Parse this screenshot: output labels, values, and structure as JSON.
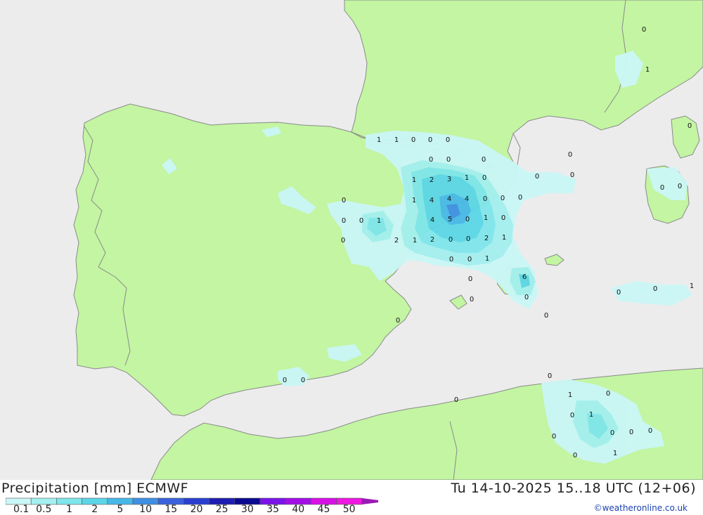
{
  "title": "Precipitation [mm] ECMWF",
  "valid_time": "Tu 14-10-2025 15..18 UTC (12+06)",
  "credit": "©weatheronline.co.uk",
  "colors": {
    "sea": "#ececec",
    "land": "#c3f5a2",
    "border": "#8a8a8a"
  },
  "legend": {
    "labels": [
      "0.1",
      "0.5",
      "1",
      "2",
      "5",
      "10",
      "15",
      "20",
      "25",
      "30",
      "35",
      "40",
      "45",
      "50"
    ],
    "colors": [
      "#caf7f7",
      "#a4efef",
      "#7fe6ea",
      "#5bd6e6",
      "#47b8e8",
      "#3f8fe3",
      "#3a62dc",
      "#2a3fd0",
      "#1e1eb2",
      "#0a0a90",
      "#7a14e8",
      "#a40ee6",
      "#d810e6",
      "#ee18e2",
      "#bb18c8",
      "#9a1ab6"
    ]
  },
  "values": [
    {
      "t": "0",
      "c": "France-north"
    },
    {
      "t": "1",
      "c": "France-north"
    },
    {
      "t": "0",
      "c": "France-east"
    },
    {
      "t": "1",
      "c": "Pyrenees"
    },
    {
      "t": "1",
      "c": "Pyrenees"
    },
    {
      "t": "0",
      "c": "Pyrenees"
    },
    {
      "t": "0",
      "c": "Pyrenees"
    },
    {
      "t": "0",
      "c": "Pyrenees"
    },
    {
      "t": "0",
      "c": "Catalonia"
    },
    {
      "t": "0",
      "c": "Catalonia"
    },
    {
      "t": "0",
      "c": "Catalonia"
    },
    {
      "t": "0",
      "c": "Med"
    },
    {
      "t": "0",
      "c": "Med"
    },
    {
      "t": "0",
      "c": "Med"
    },
    {
      "t": "0",
      "c": "Sardinia"
    },
    {
      "t": "0",
      "c": "Sardinia"
    },
    {
      "t": "1",
      "c": "Aragon"
    },
    {
      "t": "2",
      "c": "Aragon"
    },
    {
      "t": "3",
      "c": "Aragon"
    },
    {
      "t": "1",
      "c": "Aragon"
    },
    {
      "t": "0",
      "c": "Aragon"
    },
    {
      "t": "0",
      "c": "Castile"
    },
    {
      "t": "1",
      "c": "Aragon"
    },
    {
      "t": "4",
      "c": "Aragon"
    },
    {
      "t": "4",
      "c": "Aragon"
    },
    {
      "t": "4",
      "c": "Aragon"
    },
    {
      "t": "0",
      "c": "Aragon"
    },
    {
      "t": "0",
      "c": "Aragon"
    },
    {
      "t": "0",
      "c": "Aragon"
    },
    {
      "t": "0",
      "c": "Castile"
    },
    {
      "t": "0",
      "c": "Castile"
    },
    {
      "t": "1",
      "c": "Castile"
    },
    {
      "t": "4",
      "c": "Valencia"
    },
    {
      "t": "5",
      "c": "Valencia"
    },
    {
      "t": "0",
      "c": "Valencia"
    },
    {
      "t": "1",
      "c": "Valencia"
    },
    {
      "t": "0",
      "c": "Valencia"
    },
    {
      "t": "0",
      "c": "Castile"
    },
    {
      "t": "2",
      "c": "Valencia"
    },
    {
      "t": "1",
      "c": "Valencia"
    },
    {
      "t": "2",
      "c": "Valencia"
    },
    {
      "t": "0",
      "c": "Valencia"
    },
    {
      "t": "0",
      "c": "Valencia"
    },
    {
      "t": "2",
      "c": "Valencia"
    },
    {
      "t": "1",
      "c": "Valencia"
    },
    {
      "t": "0",
      "c": "Sea"
    },
    {
      "t": "0",
      "c": "Sea"
    },
    {
      "t": "1",
      "c": "Sea"
    },
    {
      "t": "6",
      "c": "Mallorca"
    },
    {
      "t": "0",
      "c": "Balearic"
    },
    {
      "t": "0",
      "c": "Balearic"
    },
    {
      "t": "0",
      "c": "Balearic"
    },
    {
      "t": "0",
      "c": "Balearic"
    },
    {
      "t": "0",
      "c": "Tyrrhenian"
    },
    {
      "t": "0",
      "c": "Tyrrhenian"
    },
    {
      "t": "1",
      "c": "Tyrrhenian"
    },
    {
      "t": "0",
      "c": "Murcia"
    },
    {
      "t": "0",
      "c": "Andalusia"
    },
    {
      "t": "0",
      "c": "Andalusia"
    },
    {
      "t": "0",
      "c": "Algeria"
    },
    {
      "t": "0",
      "c": "Algeria"
    },
    {
      "t": "1",
      "c": "Algeria"
    },
    {
      "t": "0",
      "c": "Algeria"
    },
    {
      "t": "0",
      "c": "Algeria"
    },
    {
      "t": "1",
      "c": "Algeria"
    },
    {
      "t": "0",
      "c": "Algeria"
    },
    {
      "t": "0",
      "c": "Algeria"
    },
    {
      "t": "0",
      "c": "Algeria"
    },
    {
      "t": "0",
      "c": "Algeria"
    },
    {
      "t": "0",
      "c": "Algeria"
    },
    {
      "t": "1",
      "c": "Algeria"
    }
  ]
}
